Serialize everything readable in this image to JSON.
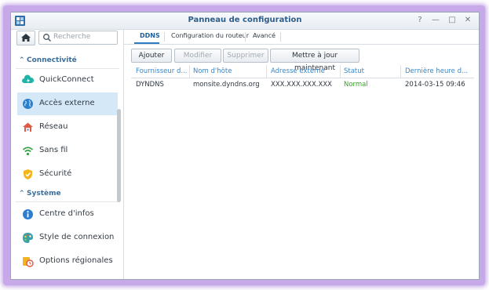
{
  "window": {
    "title": "Panneau de configuration",
    "controls": {
      "help": "?",
      "minimize": "—",
      "maximize": "□",
      "close": "✕"
    }
  },
  "sidebar": {
    "search_placeholder": "Recherche",
    "sections": [
      {
        "label": "Connectivité",
        "items": [
          {
            "label": "QuickConnect",
            "icon": "quickconnect-icon"
          },
          {
            "label": "Accès externe",
            "icon": "globe-icon",
            "active": true
          },
          {
            "label": "Réseau",
            "icon": "network-house-icon"
          },
          {
            "label": "Sans fil",
            "icon": "wifi-icon"
          },
          {
            "label": "Sécurité",
            "icon": "shield-icon"
          }
        ]
      },
      {
        "label": "Système",
        "items": [
          {
            "label": "Centre d'infos",
            "icon": "info-icon"
          },
          {
            "label": "Style de connexion",
            "icon": "palette-icon"
          },
          {
            "label": "Options régionales",
            "icon": "regional-clock-icon"
          }
        ]
      }
    ]
  },
  "tabs": [
    {
      "label": "DDNS",
      "active": true
    },
    {
      "label": "Configuration du routeur"
    },
    {
      "label": "Avancé"
    }
  ],
  "toolbar": {
    "add": "Ajouter",
    "edit": "Modifier",
    "delete": "Supprimer",
    "update_now": "Mettre à jour maintenant"
  },
  "grid": {
    "columns": [
      "Fournisseur d...",
      "Nom d'hôte",
      "Adresse externe",
      "Statut",
      "Dernière heure d..."
    ],
    "rows": [
      [
        "DYNDNS",
        "monsite.dyndns.org",
        "XXX.XXX.XXX.XXX",
        "Normal",
        "2014-03-15 09:46"
      ]
    ]
  },
  "colors": {
    "accent": "#3a86c8",
    "selected_row": "#d5e8f8",
    "status_ok": "#3aa02c",
    "glow": "#c7a9e9"
  }
}
